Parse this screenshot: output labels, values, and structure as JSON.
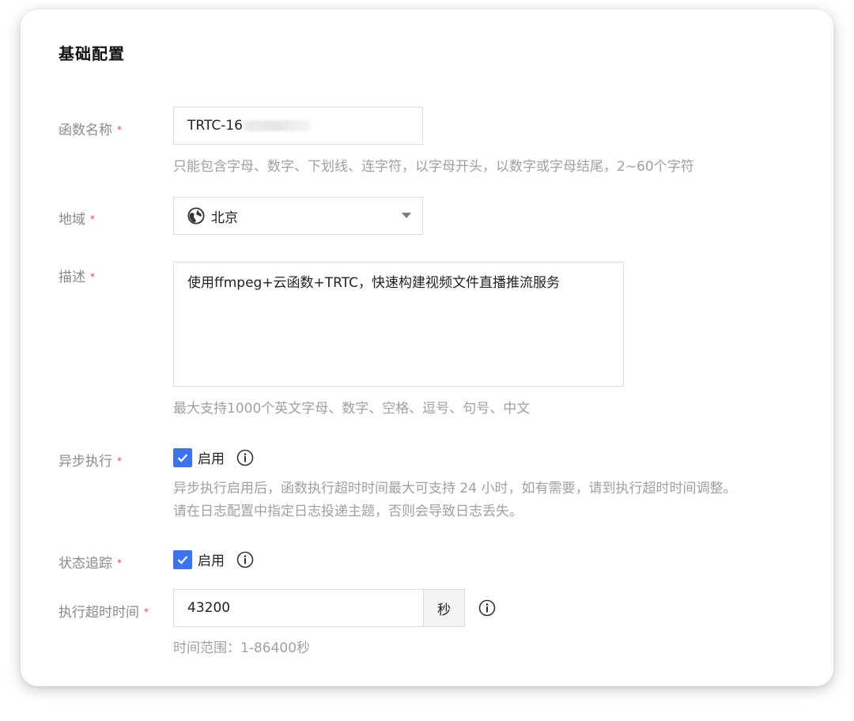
{
  "section": {
    "title": "基础配置"
  },
  "fields": {
    "function_name": {
      "label": "函数名称",
      "required_mark": "*",
      "value_visible": "TRTC-16",
      "hint": "只能包含字母、数字、下划线、连字符，以字母开头，以数字或字母结尾，2~60个字符"
    },
    "region": {
      "label": "地域",
      "required_mark": "*",
      "selected": "北京",
      "icon": "globe-icon"
    },
    "description": {
      "label": "描述",
      "required_mark": "*",
      "value": "使用ffmpeg+云函数+TRTC，快速构建视频文件直播推流服务",
      "hint": "最大支持1000个英文字母、数字、空格、逗号、句号、中文"
    },
    "async_exec": {
      "label": "异步执行",
      "required_mark": "*",
      "checkbox_label": "启用",
      "checked": true,
      "hint_line1": "异步执行启用后，函数执行超时时间最大可支持 24 小时，如有需要，请到执行超时时间调整。",
      "hint_line2": "请在日志配置中指定日志投递主题，否则会导致日志丢失。"
    },
    "status_tracking": {
      "label": "状态追踪",
      "required_mark": "*",
      "checkbox_label": "启用",
      "checked": true
    },
    "timeout": {
      "label": "执行超时时间",
      "required_mark": "*",
      "value": "43200",
      "unit": "秒",
      "hint": "时间范围：1-86400秒"
    }
  },
  "colors": {
    "accent": "#3b73f2",
    "required": "#e54545",
    "label": "#8a8a8a",
    "hint": "#a0a0a0"
  }
}
